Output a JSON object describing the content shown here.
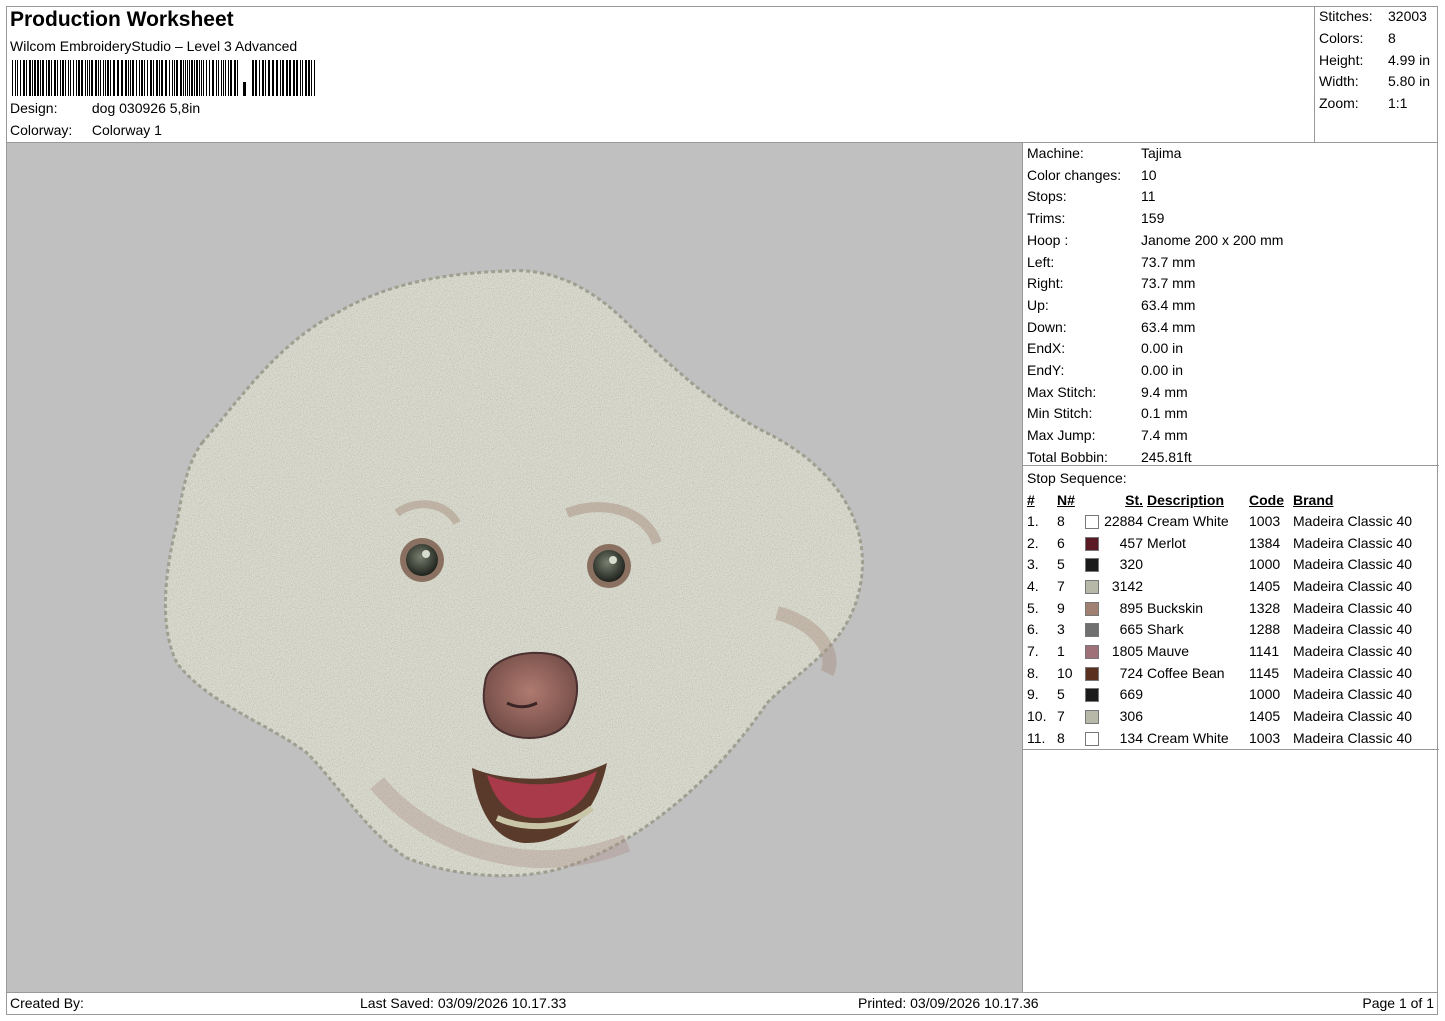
{
  "header": {
    "title": "Production Worksheet",
    "software": "Wilcom EmbroideryStudio – Level 3 Advanced",
    "design_label": "Design:",
    "design_value": "dog 030926 5,8in",
    "colorway_label": "Colorway:",
    "colorway_value": "Colorway 1"
  },
  "stats": [
    {
      "label": "Stitches:",
      "value": "32003"
    },
    {
      "label": "Colors:",
      "value": "8"
    },
    {
      "label": "Height:",
      "value": "4.99 in"
    },
    {
      "label": "Width:",
      "value": "5.80 in"
    },
    {
      "label": "Zoom:",
      "value": "1:1"
    }
  ],
  "machine": [
    {
      "label": "Machine:",
      "value": "Tajima"
    },
    {
      "label": "Color changes:",
      "value": "10"
    },
    {
      "label": "Stops:",
      "value": "11"
    },
    {
      "label": "Trims:",
      "value": "159"
    },
    {
      "label": "Hoop :",
      "value": "Janome 200 x 200 mm"
    },
    {
      "label": "Left:",
      "value": "73.7 mm"
    },
    {
      "label": "Right:",
      "value": "73.7 mm"
    },
    {
      "label": "Up:",
      "value": "63.4 mm"
    },
    {
      "label": "Down:",
      "value": "63.4 mm"
    },
    {
      "label": "EndX:",
      "value": "0.00 in"
    },
    {
      "label": "EndY:",
      "value": "0.00 in"
    },
    {
      "label": "Max Stitch:",
      "value": "9.4 mm"
    },
    {
      "label": "Min Stitch:",
      "value": "0.1 mm"
    },
    {
      "label": "Max Jump:",
      "value": "7.4 mm"
    },
    {
      "label": "Total Bobbin:",
      "value": "245.81ft"
    }
  ],
  "stop_sequence": {
    "title": "Stop Sequence:",
    "headers": {
      "num": "#",
      "n": "N#",
      "st": "St.",
      "desc": "Description",
      "code": "Code",
      "brand": "Brand"
    },
    "rows": [
      {
        "num": "1.",
        "n": "8",
        "color": "#ffffff",
        "st": "22884",
        "desc": "Cream White",
        "code": "1003",
        "brand": "Madeira Classic 40"
      },
      {
        "num": "2.",
        "n": "6",
        "color": "#5a1a24",
        "st": "457",
        "desc": "Merlot",
        "code": "1384",
        "brand": "Madeira Classic 40"
      },
      {
        "num": "3.",
        "n": "5",
        "color": "#1a1a1a",
        "st": "320",
        "desc": "",
        "code": "1000",
        "brand": "Madeira Classic 40"
      },
      {
        "num": "4.",
        "n": "7",
        "color": "#b8b8a8",
        "st": "3142",
        "desc": "",
        "code": "1405",
        "brand": "Madeira Classic 40"
      },
      {
        "num": "5.",
        "n": "9",
        "color": "#a08070",
        "st": "895",
        "desc": "Buckskin",
        "code": "1328",
        "brand": "Madeira Classic 40"
      },
      {
        "num": "6.",
        "n": "3",
        "color": "#707070",
        "st": "665",
        "desc": "Shark",
        "code": "1288",
        "brand": "Madeira Classic 40"
      },
      {
        "num": "7.",
        "n": "1",
        "color": "#a07078",
        "st": "1805",
        "desc": "Mauve",
        "code": "1141",
        "brand": "Madeira Classic 40"
      },
      {
        "num": "8.",
        "n": "10",
        "color": "#5a3020",
        "st": "724",
        "desc": "Coffee Bean",
        "code": "1145",
        "brand": "Madeira Classic 40"
      },
      {
        "num": "9.",
        "n": "5",
        "color": "#1a1a1a",
        "st": "669",
        "desc": "",
        "code": "1000",
        "brand": "Madeira Classic 40"
      },
      {
        "num": "10.",
        "n": "7",
        "color": "#b8b8a8",
        "st": "306",
        "desc": "",
        "code": "1405",
        "brand": "Madeira Classic 40"
      },
      {
        "num": "11.",
        "n": "8",
        "color": "#ffffff",
        "st": "134",
        "desc": "Cream White",
        "code": "1003",
        "brand": "Madeira Classic 40"
      }
    ]
  },
  "footer": {
    "created_by": "Created By:",
    "last_saved": "Last Saved: 03/09/2026 10.17.33",
    "printed": "Printed: 03/09/2026 10.17.36",
    "page": "Page 1 of 1"
  }
}
